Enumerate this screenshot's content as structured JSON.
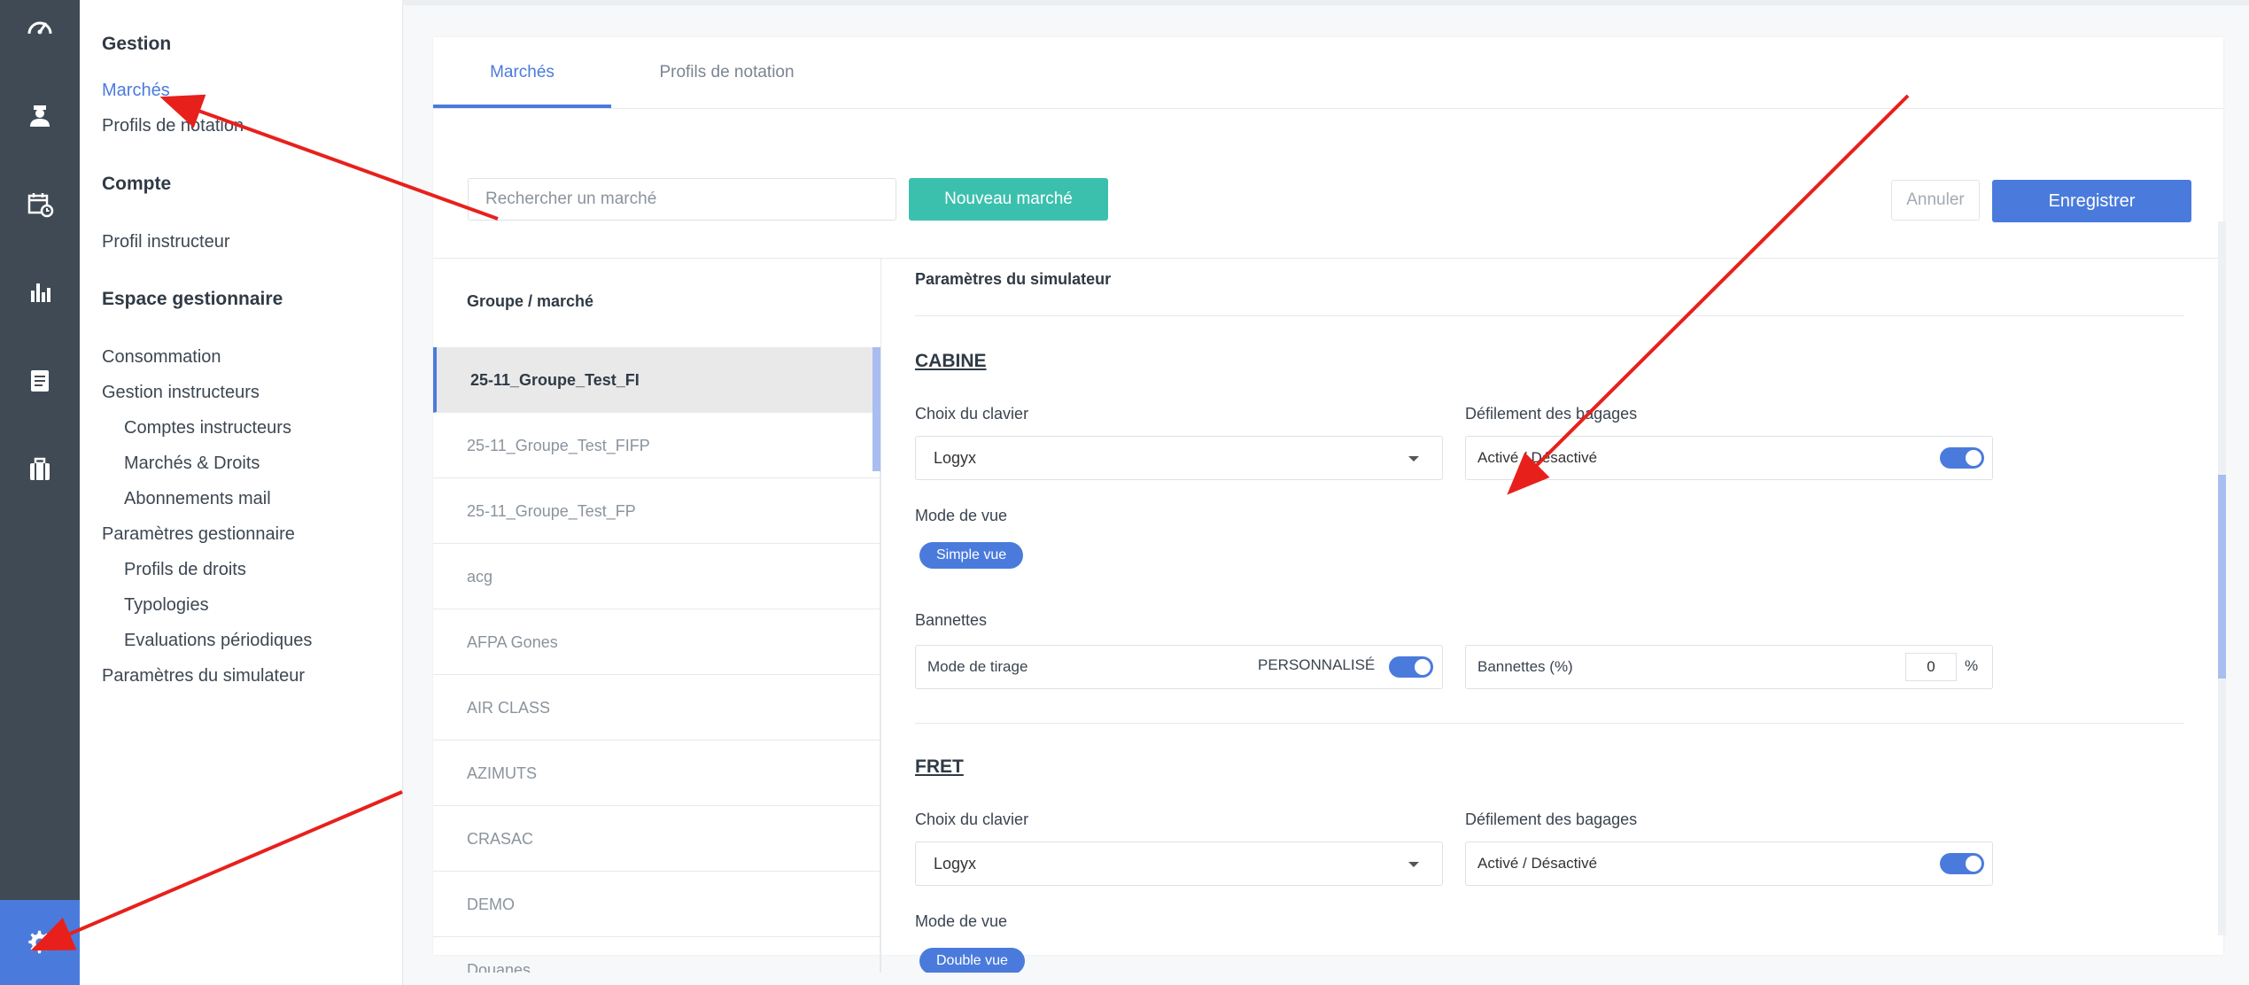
{
  "sidebar": {
    "sections": [
      {
        "title": "Gestion",
        "items": [
          "Marchés",
          "Profils de notation"
        ]
      },
      {
        "title": "Compte",
        "items": [
          "Profil instructeur"
        ]
      },
      {
        "title": "Espace gestionnaire",
        "items": [
          "Consommation",
          "Gestion instructeurs",
          "Comptes instructeurs",
          "Marchés & Droits",
          "Abonnements mail",
          "Paramètres gestionnaire",
          "Profils de droits",
          "Typologies",
          "Evaluations périodiques",
          "Paramètres du simulateur"
        ]
      }
    ],
    "active_item": "Marchés"
  },
  "rail": {
    "icons": [
      "dashboard-gauge-icon",
      "instructor-user-icon",
      "calendar-clock-icon",
      "bar-chart-icon",
      "document-list-icon",
      "briefcase-icon"
    ],
    "settings_icon": "gear-icon",
    "settings_color": "#4a7bdc"
  },
  "tabs": [
    {
      "label": "Marchés",
      "active": true
    },
    {
      "label": "Profils de notation",
      "active": false
    }
  ],
  "toolbar": {
    "search_placeholder": "Rechercher un marché",
    "new_label": "Nouveau marché",
    "cancel_label": "Annuler",
    "save_label": "Enregistrer"
  },
  "list": {
    "header": "Groupe / marché",
    "items": [
      "25-11_Groupe_Test_FI",
      "25-11_Groupe_Test_FIFP",
      "25-11_Groupe_Test_FP",
      "acg",
      "AFPA Gones",
      "AIR CLASS",
      "AZIMUTS",
      "CRASAC",
      "DEMO",
      "Douanes"
    ],
    "selected_index": 0
  },
  "detail": {
    "title": "Paramètres du simulateur",
    "cabine": {
      "title": "CABINE",
      "keyboard_label": "Choix du clavier",
      "keyboard_value": "Logyx",
      "baggage_label": "Défilement des bagages",
      "baggage_value": "Activé / Désactivé",
      "baggage_on": true,
      "view_label": "Mode de vue",
      "view_value": "Simple vue",
      "bannettes_label": "Bannettes",
      "draw_mode_label": "Mode de tirage",
      "draw_mode_value": "PERSONNALISÉ",
      "draw_mode_on": true,
      "bannettes_pct_label": "Bannettes (%)",
      "bannettes_pct_value": "0",
      "pct_unit": "%"
    },
    "fret": {
      "title": "FRET",
      "keyboard_label": "Choix du clavier",
      "keyboard_value": "Logyx",
      "baggage_label": "Défilement des bagages",
      "baggage_value": "Activé / Désactivé",
      "baggage_on": true,
      "view_label": "Mode de vue",
      "view_value": "Double vue"
    }
  },
  "colors": {
    "accent": "#4a7bdc",
    "teal": "#3cc0ae",
    "rail": "#3f4a54",
    "annotation_arrow": "#e8201c"
  }
}
